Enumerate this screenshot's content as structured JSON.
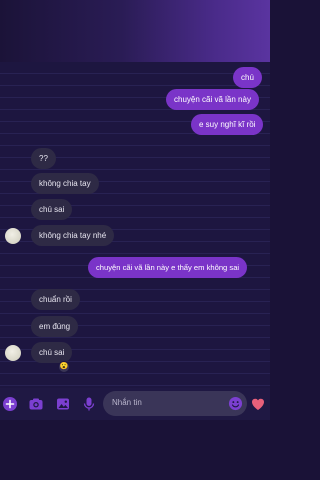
{
  "messages": [
    {
      "text": "chú",
      "dir": "out"
    },
    {
      "text": "chuyện cãi vã lần này",
      "dir": "out"
    },
    {
      "text": "e suy nghĩ kĩ rồi",
      "dir": "out"
    },
    {
      "text": "??",
      "dir": "in"
    },
    {
      "text": "không chia tay",
      "dir": "in"
    },
    {
      "text": "chú sai",
      "dir": "in"
    },
    {
      "text": "không chia tay nhé",
      "dir": "in"
    },
    {
      "text": "chuyện cãi vã lần này e thấy em không sai",
      "dir": "out"
    },
    {
      "text": "chuẩn rồi",
      "dir": "in"
    },
    {
      "text": "em đúng",
      "dir": "in"
    },
    {
      "text": "chú sai",
      "dir": "in"
    }
  ],
  "reaction_emoji": "😮",
  "composer": {
    "placeholder": "Nhắn tin",
    "icons": [
      "plus-icon",
      "camera-icon",
      "image-icon",
      "mic-icon",
      "emoji-icon",
      "heart-icon"
    ]
  },
  "colors": {
    "outgoing_bubble": "#7a34c8",
    "incoming_bubble": "#2e2a45",
    "heart": "#e8607a"
  }
}
